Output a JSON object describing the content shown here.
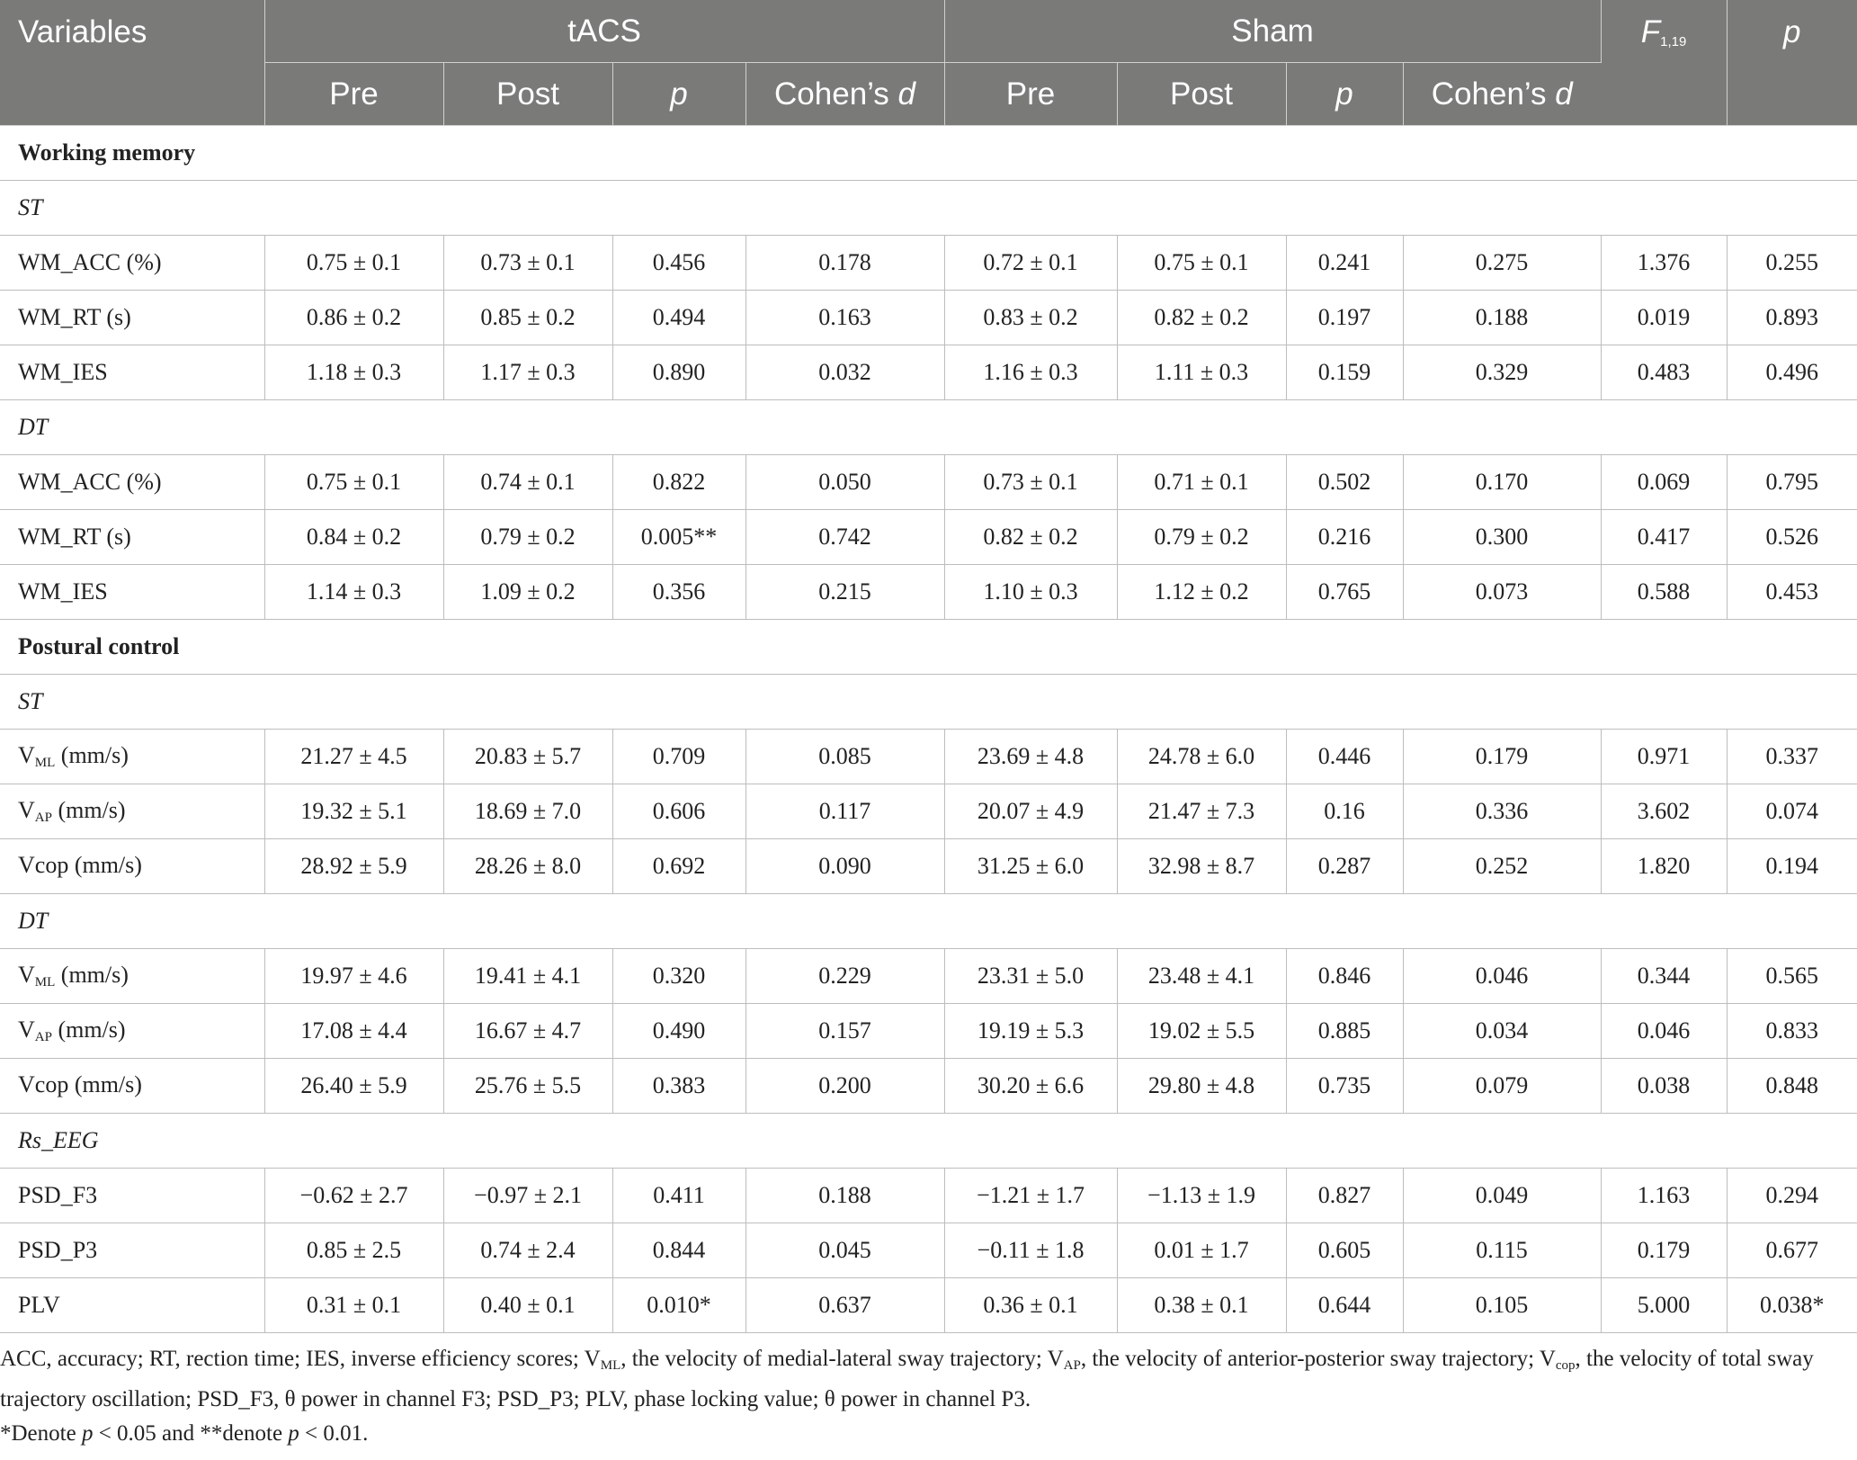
{
  "header": {
    "variables": "Variables",
    "tacs": "tACS",
    "sham": "Sham",
    "f_label": "F",
    "f_sub": "1,19",
    "p": "p",
    "pre": "Pre",
    "post": "Post",
    "cohens": "Cohen’s ",
    "d": "d"
  },
  "sections": {
    "wm": "Working memory",
    "pc": "Postural control",
    "st": "ST",
    "dt": "DT",
    "eeg": "Rs_EEG"
  },
  "rows": {
    "wm_st": [
      {
        "label": "WM_ACC (%)",
        "v": [
          "0.75 ± 0.1",
          "0.73 ± 0.1",
          "0.456",
          "0.178",
          "0.72 ± 0.1",
          "0.75 ± 0.1",
          "0.241",
          "0.275",
          "1.376",
          "0.255"
        ]
      },
      {
        "label": "WM_RT (s)",
        "v": [
          "0.86 ± 0.2",
          "0.85 ± 0.2",
          "0.494",
          "0.163",
          "0.83 ± 0.2",
          "0.82 ± 0.2",
          "0.197",
          "0.188",
          "0.019",
          "0.893"
        ]
      },
      {
        "label": "WM_IES",
        "v": [
          "1.18 ± 0.3",
          "1.17 ± 0.3",
          "0.890",
          "0.032",
          "1.16 ± 0.3",
          "1.11 ± 0.3",
          "0.159",
          "0.329",
          "0.483",
          "0.496"
        ]
      }
    ],
    "wm_dt": [
      {
        "label": "WM_ACC (%)",
        "v": [
          "0.75 ± 0.1",
          "0.74 ± 0.1",
          "0.822",
          "0.050",
          "0.73 ± 0.1",
          "0.71 ± 0.1",
          "0.502",
          "0.170",
          "0.069",
          "0.795"
        ]
      },
      {
        "label": "WM_RT (s)",
        "v": [
          "0.84 ± 0.2",
          "0.79 ± 0.2",
          "0.005**",
          "0.742",
          "0.82 ± 0.2",
          "0.79 ± 0.2",
          "0.216",
          "0.300",
          "0.417",
          "0.526"
        ]
      },
      {
        "label": "WM_IES",
        "v": [
          "1.14 ± 0.3",
          "1.09 ± 0.2",
          "0.356",
          "0.215",
          "1.10 ± 0.3",
          "1.12 ± 0.2",
          "0.765",
          "0.073",
          "0.588",
          "0.453"
        ]
      }
    ],
    "pc_st": [
      {
        "base": "V",
        "sub": "ML",
        "unit": " (mm/s)",
        "v": [
          "21.27 ± 4.5",
          "20.83 ± 5.7",
          "0.709",
          "0.085",
          "23.69 ± 4.8",
          "24.78 ± 6.0",
          "0.446",
          "0.179",
          "0.971",
          "0.337"
        ]
      },
      {
        "base": "V",
        "sub": "AP",
        "unit": " (mm/s)",
        "v": [
          "19.32 ± 5.1",
          "18.69 ± 7.0",
          "0.606",
          "0.117",
          "20.07 ± 4.9",
          "21.47 ± 7.3",
          "0.16",
          "0.336",
          "3.602",
          "0.074"
        ]
      },
      {
        "base": "Vcop",
        "sub": "",
        "unit": " (mm/s)",
        "v": [
          "28.92 ± 5.9",
          "28.26 ± 8.0",
          "0.692",
          "0.090",
          "31.25 ± 6.0",
          "32.98 ± 8.7",
          "0.287",
          "0.252",
          "1.820",
          "0.194"
        ]
      }
    ],
    "pc_dt": [
      {
        "base": "V",
        "sub": "ML",
        "unit": " (mm/s)",
        "v": [
          "19.97 ± 4.6",
          "19.41 ± 4.1",
          "0.320",
          "0.229",
          "23.31 ± 5.0",
          "23.48 ± 4.1",
          "0.846",
          "0.046",
          "0.344",
          "0.565"
        ]
      },
      {
        "base": "V",
        "sub": "AP",
        "unit": " (mm/s)",
        "v": [
          "17.08 ± 4.4",
          "16.67 ± 4.7",
          "0.490",
          "0.157",
          "19.19 ± 5.3",
          "19.02 ± 5.5",
          "0.885",
          "0.034",
          "0.046",
          "0.833"
        ]
      },
      {
        "base": "Vcop",
        "sub": "",
        "unit": " (mm/s)",
        "v": [
          "26.40 ± 5.9",
          "25.76 ± 5.5",
          "0.383",
          "0.200",
          "30.20 ± 6.6",
          "29.80 ± 4.8",
          "0.735",
          "0.079",
          "0.038",
          "0.848"
        ]
      }
    ],
    "eeg": [
      {
        "label": "PSD_F3",
        "v": [
          "−0.62 ± 2.7",
          "−0.97 ± 2.1",
          "0.411",
          "0.188",
          "−1.21 ± 1.7",
          "−1.13 ± 1.9",
          "0.827",
          "0.049",
          "1.163",
          "0.294"
        ]
      },
      {
        "label": "PSD_P3",
        "v": [
          "0.85 ± 2.5",
          "0.74 ± 2.4",
          "0.844",
          "0.045",
          "−0.11 ± 1.8",
          "0.01 ± 1.7",
          "0.605",
          "0.115",
          "0.179",
          "0.677"
        ]
      },
      {
        "label": "PLV",
        "v": [
          "0.31 ± 0.1",
          "0.40 ± 0.1",
          "0.010*",
          "0.637",
          "0.36 ± 0.1",
          "0.38 ± 0.1",
          "0.644",
          "0.105",
          "5.000",
          "0.038*"
        ]
      }
    ]
  },
  "footnote": {
    "a1": "ACC, accuracy; RT, rection time; IES, inverse efficiency scores; V",
    "a1s": "ML",
    "a2": ", the velocity of medial-lateral sway trajectory; V",
    "a2s": "AP",
    "a3": ", the velocity of anterior-posterior sway trajectory; V",
    "a3s": "cop",
    "a4": ", the velocity of total sway trajectory oscillation; PSD_F3, θ power in channel F3; PSD_P3; PLV, phase locking value; θ power in channel P3.",
    "b1": "*Denote ",
    "b_p1": "p",
    "b2": " < 0.05 and **denote ",
    "b_p2": "p",
    "b3": " < 0.01."
  }
}
